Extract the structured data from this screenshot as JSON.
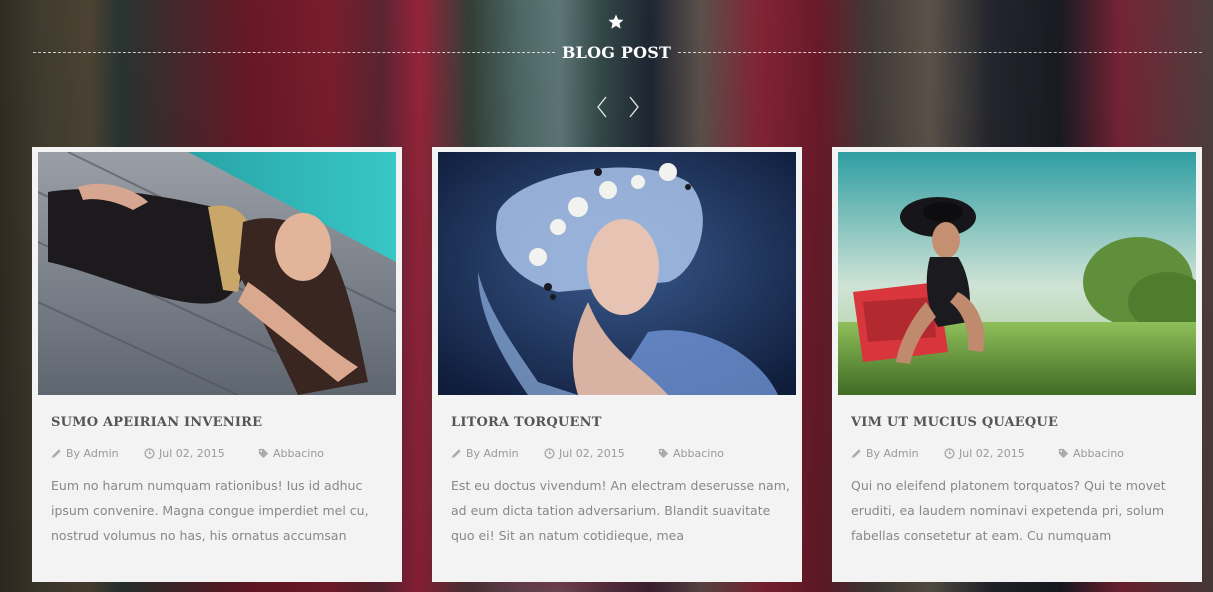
{
  "section": {
    "title": "BLOG POST",
    "icon": "star-icon"
  },
  "carousel": {
    "prev_icon": "chevron-left-icon",
    "next_icon": "chevron-right-icon"
  },
  "colors": {
    "card_bg": "#f3f3f3",
    "title_text": "#555555",
    "meta_text": "#999999",
    "excerpt_text": "#888888"
  },
  "posts": [
    {
      "title": "SUMO APEIRIAN INVENIRE",
      "author": "By Admin",
      "date": "Jul 02, 2015",
      "tag": "Abbacino",
      "excerpt": "Eum no harum numquam rationibus! Ius id adhuc ipsum convenire. Magna congue imperdiet mel cu, nostrud volumus no has, his ornatus accumsan"
    },
    {
      "title": "LITORA TORQUENT",
      "author": "By Admin",
      "date": "Jul 02, 2015",
      "tag": "Abbacino",
      "excerpt": "Est eu doctus vivendum! An electram deserusse nam, ad eum dicta tation adversarium. Blandit suavitate quo ei! Sit an natum cotidieque, mea"
    },
    {
      "title": "VIM UT MUCIUS QUAEQUE",
      "author": "By Admin",
      "date": "Jul 02, 2015",
      "tag": "Abbacino",
      "excerpt": "Qui no eleifend platonem torquatos? Qui te movet eruditi, ea laudem nominavi expetenda pri, solum fabellas consetetur at eam. Cu numquam"
    }
  ]
}
